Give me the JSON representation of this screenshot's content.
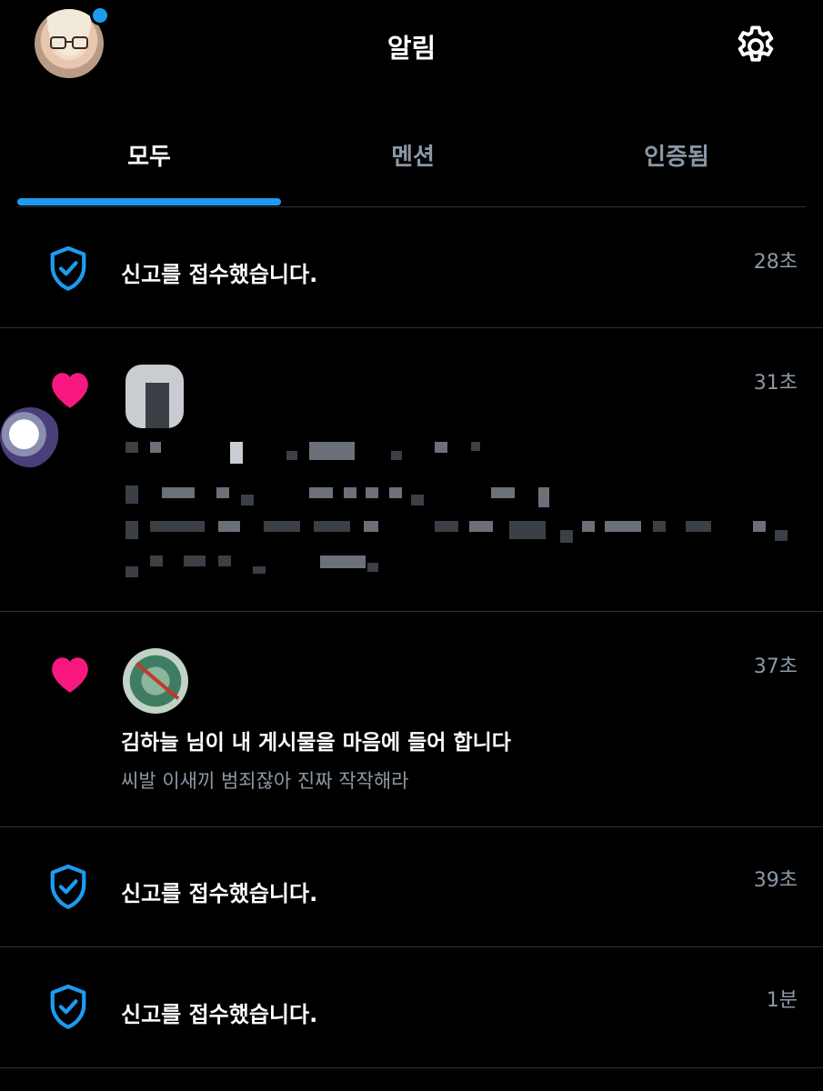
{
  "header": {
    "title": "알림"
  },
  "tabs": [
    {
      "label": "모두",
      "active": true
    },
    {
      "label": "멘션",
      "active": false
    },
    {
      "label": "인증됨",
      "active": false
    }
  ],
  "notifications": [
    {
      "type": "report",
      "icon": "shield-check-icon",
      "text": "신고를 접수했습니다.",
      "time": "28초"
    },
    {
      "type": "like",
      "icon": "heart-icon",
      "text": "",
      "time": "31초",
      "content_blurred": true
    },
    {
      "type": "like",
      "icon": "heart-icon",
      "text": "김하늘 님이 내 게시물을 마음에 들어 합니다",
      "subtext": "씨발 이새끼 범죄잖아 진짜 작작해라",
      "time": "37초"
    },
    {
      "type": "report",
      "icon": "shield-check-icon",
      "text": "신고를 접수했습니다.",
      "time": "39초"
    },
    {
      "type": "report",
      "icon": "shield-check-icon",
      "text": "신고를 접수했습니다.",
      "time": "1분"
    }
  ],
  "colors": {
    "accent": "#1d9bf0",
    "heart": "#f91880",
    "background": "#000000"
  }
}
